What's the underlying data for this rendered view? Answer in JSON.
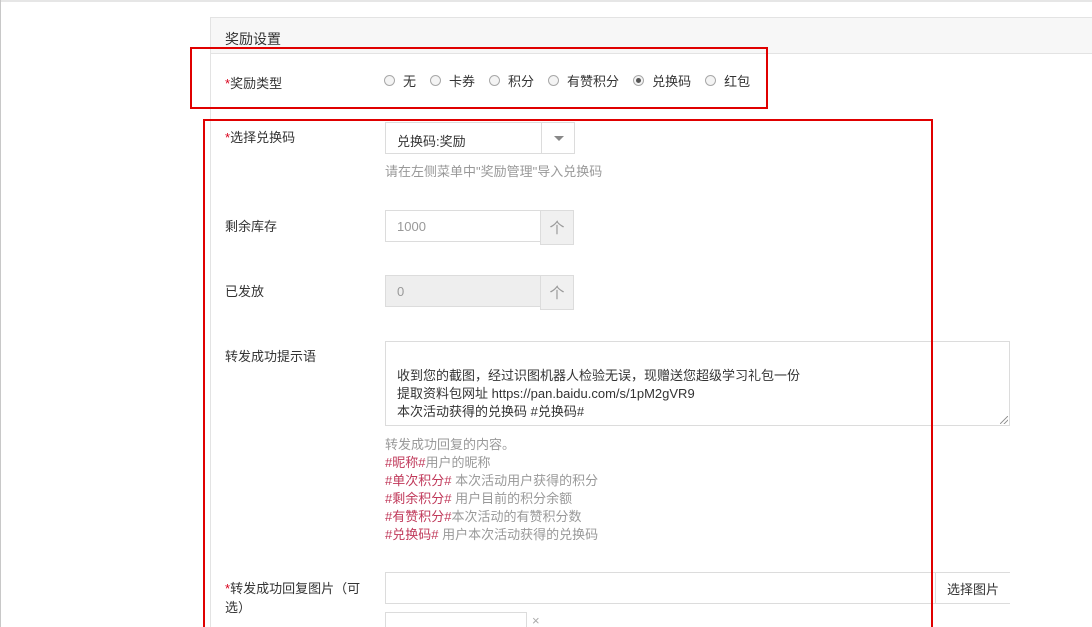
{
  "panel": {
    "title": "奖励设置"
  },
  "reward_type": {
    "label": "奖励类型",
    "required_mark": "*",
    "options": [
      {
        "label": "无",
        "checked": false
      },
      {
        "label": "卡券",
        "checked": false
      },
      {
        "label": "积分",
        "checked": false
      },
      {
        "label": "有赞积分",
        "checked": false
      },
      {
        "label": "兑换码",
        "checked": true
      },
      {
        "label": "红包",
        "checked": false
      }
    ]
  },
  "code_select": {
    "label": "选择兑换码",
    "required_mark": "*",
    "value": "兑换码:奖励",
    "help": "请在左侧菜单中\"奖励管理\"导入兑换码"
  },
  "stock": {
    "label": "剩余库存",
    "value": "1000",
    "step_icon": "up-arrow-icon",
    "step_glyph": "个"
  },
  "issued": {
    "label": "已发放",
    "value": "0",
    "step_icon": "up-arrow-icon",
    "step_glyph": "个"
  },
  "success_message": {
    "label": "转发成功提示语",
    "text": "收到您的截图，经过识图机器人检验无误，现赠送您超级学习礼包一份\n提取资料包网址 https://pan.baidu.com/s/1pM2gVR9\n本次活动获得的兑换码 #兑换码#",
    "help": "转发成功回复的内容。",
    "variables": [
      {
        "tag": "#昵称#",
        "desc": "用户的昵称"
      },
      {
        "tag": "#单次积分#",
        "desc": " 本次活动用户获得的积分"
      },
      {
        "tag": "#剩余积分#",
        "desc": " 用户目前的积分余额"
      },
      {
        "tag": "#有赞积分#",
        "desc": "本次活动的有赞积分数"
      },
      {
        "tag": "#兑换码#",
        "desc": " 用户本次活动获得的兑换码"
      }
    ]
  },
  "reply_image": {
    "required_mark": "*",
    "label_line1": "转发成功回复图片（可",
    "label_line2": "选）",
    "button": "选择图片",
    "close_glyph": "×"
  },
  "colors": {
    "highlight_border": "#e00000",
    "required": "#d9001b",
    "variable_tag": "#c0395a"
  }
}
